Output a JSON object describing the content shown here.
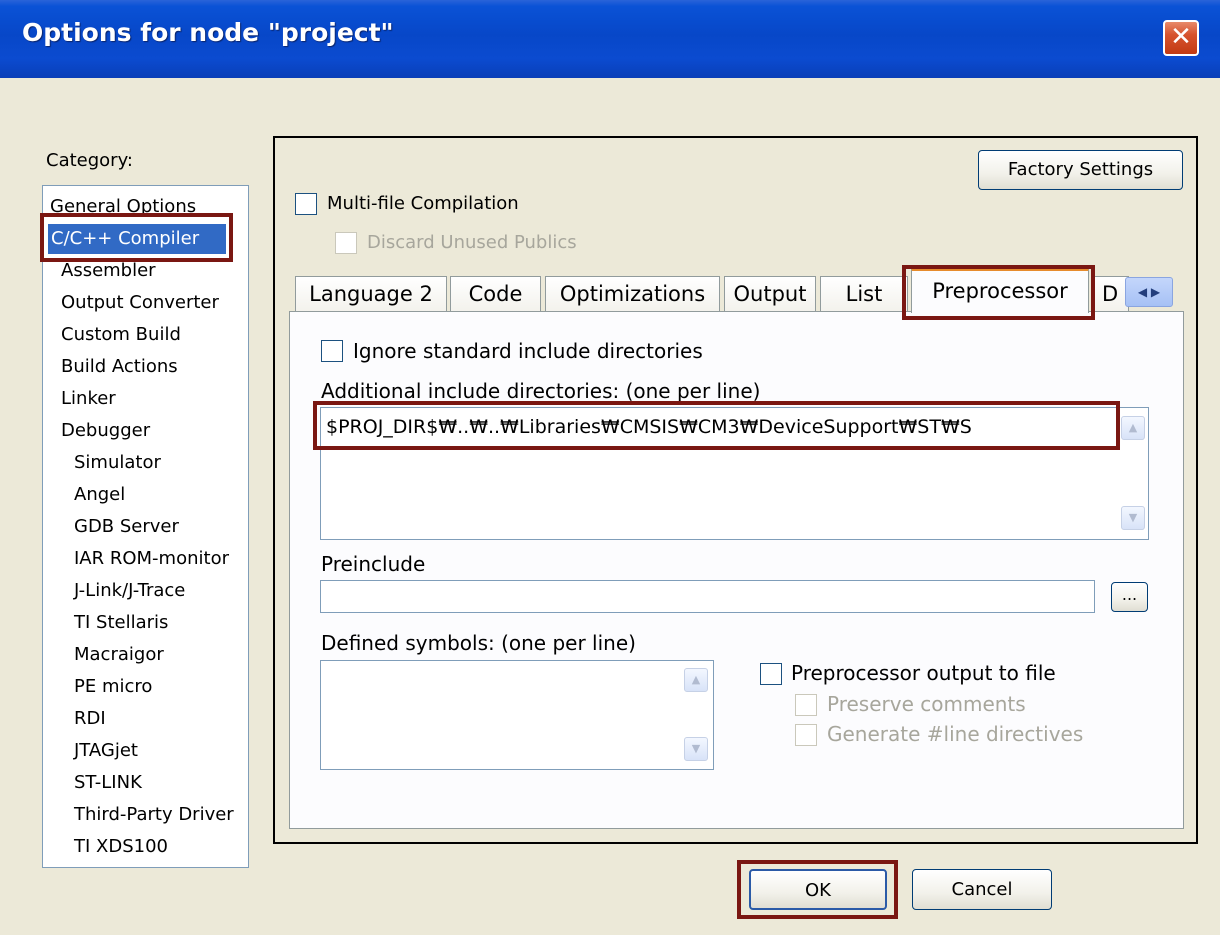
{
  "window": {
    "title": "Options for node \"project\"",
    "close_glyph": "✕"
  },
  "category": {
    "label": "Category:",
    "items": [
      {
        "label": "General Options"
      },
      {
        "label": "C/C++ Compiler"
      },
      {
        "label": "Assembler"
      },
      {
        "label": "Output Converter"
      },
      {
        "label": "Custom Build"
      },
      {
        "label": "Build Actions"
      },
      {
        "label": "Linker"
      },
      {
        "label": "Debugger"
      },
      {
        "label": "Simulator"
      },
      {
        "label": "Angel"
      },
      {
        "label": "GDB Server"
      },
      {
        "label": "IAR ROM-monitor"
      },
      {
        "label": "J-Link/J-Trace"
      },
      {
        "label": "TI Stellaris"
      },
      {
        "label": "Macraigor"
      },
      {
        "label": "PE micro"
      },
      {
        "label": "RDI"
      },
      {
        "label": "JTAGjet"
      },
      {
        "label": "ST-LINK"
      },
      {
        "label": "Third-Party Driver"
      },
      {
        "label": "TI XDS100"
      }
    ],
    "selected": "C/C++ Compiler"
  },
  "top": {
    "factory_settings": "Factory Settings",
    "multi_file": "Multi-file Compilation",
    "discard_unused": "Discard Unused Publics"
  },
  "tabs": [
    {
      "label": "Language 2"
    },
    {
      "label": "Code"
    },
    {
      "label": "Optimizations"
    },
    {
      "label": "Output"
    },
    {
      "label": "List"
    },
    {
      "label": "Preprocessor"
    },
    {
      "label": "D"
    }
  ],
  "active_tab": "Preprocessor",
  "tab_scroll": {
    "left": "◀",
    "right": "▶"
  },
  "preprocessor": {
    "ignore_std": "Ignore standard include directories",
    "additional_label": "Additional include directories: (one per line)",
    "additional_value": "$PROJ_DIR$₩..₩..₩Libraries₩CMSIS₩CM3₩DeviceSupport₩ST₩S",
    "preinclude_label": "Preinclude",
    "preinclude_value": "",
    "browse": "...",
    "defined_label": "Defined symbols: (one per line)",
    "defined_value": "",
    "output_to_file": "Preprocessor output to file",
    "preserve_comments": "Preserve comments",
    "generate_line": "Generate #line directives",
    "scroll_up": "▲",
    "scroll_down": "▼"
  },
  "buttons": {
    "ok": "OK",
    "cancel": "Cancel"
  },
  "colors": {
    "titlebar": "#0a52d6",
    "selection": "#316ac5",
    "highlight_box": "#7a1712",
    "active_tab_accent": "#e68b2c"
  }
}
